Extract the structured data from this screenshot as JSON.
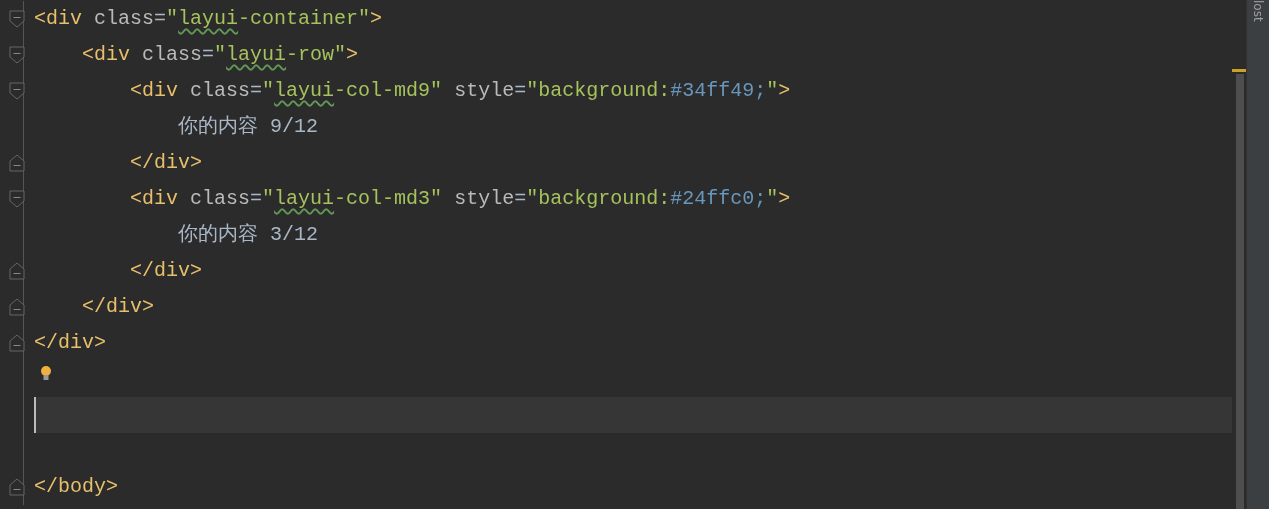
{
  "editor": {
    "lines": [
      {
        "kind": "open",
        "current": false,
        "bulb": false,
        "tokens": [
          {
            "kind": "tag",
            "text": "<div"
          },
          {
            "kind": "attr",
            "text": " class"
          },
          {
            "kind": "punct",
            "text": "="
          },
          {
            "kind": "string",
            "text": "\""
          },
          {
            "kind": "typo",
            "text": "layui"
          },
          {
            "kind": "string",
            "text": "-container\""
          },
          {
            "kind": "tag",
            "text": ">"
          }
        ]
      },
      {
        "kind": "open",
        "current": false,
        "bulb": false,
        "tokens": [
          {
            "kind": "tag",
            "text": "    <div"
          },
          {
            "kind": "attr",
            "text": " class"
          },
          {
            "kind": "punct",
            "text": "="
          },
          {
            "kind": "string",
            "text": "\""
          },
          {
            "kind": "typo",
            "text": "layui"
          },
          {
            "kind": "string",
            "text": "-row\""
          },
          {
            "kind": "tag",
            "text": ">"
          }
        ]
      },
      {
        "kind": "open",
        "current": false,
        "bulb": false,
        "tokens": [
          {
            "kind": "tag",
            "text": "        <div"
          },
          {
            "kind": "attr",
            "text": " class"
          },
          {
            "kind": "punct",
            "text": "="
          },
          {
            "kind": "string",
            "text": "\""
          },
          {
            "kind": "typo",
            "text": "layui"
          },
          {
            "kind": "string",
            "text": "-col-md9\""
          },
          {
            "kind": "attr",
            "text": " style"
          },
          {
            "kind": "punct",
            "text": "="
          },
          {
            "kind": "string",
            "text": "\"background:"
          },
          {
            "kind": "css",
            "text": "#34ff49;"
          },
          {
            "kind": "string",
            "text": "\""
          },
          {
            "kind": "tag",
            "text": ">"
          }
        ]
      },
      {
        "kind": "plain",
        "current": false,
        "bulb": false,
        "tokens": [
          {
            "kind": "text",
            "text": "            你的内容 9/12"
          }
        ]
      },
      {
        "kind": "close",
        "current": false,
        "bulb": false,
        "tokens": [
          {
            "kind": "tag",
            "text": "        </div>"
          }
        ]
      },
      {
        "kind": "open",
        "current": false,
        "bulb": false,
        "tokens": [
          {
            "kind": "tag",
            "text": "        <div"
          },
          {
            "kind": "attr",
            "text": " class"
          },
          {
            "kind": "punct",
            "text": "="
          },
          {
            "kind": "string",
            "text": "\""
          },
          {
            "kind": "typo",
            "text": "layui"
          },
          {
            "kind": "string",
            "text": "-col-md3\""
          },
          {
            "kind": "attr",
            "text": " style"
          },
          {
            "kind": "punct",
            "text": "="
          },
          {
            "kind": "string",
            "text": "\"background:"
          },
          {
            "kind": "css",
            "text": "#24ffc0;"
          },
          {
            "kind": "string",
            "text": "\""
          },
          {
            "kind": "tag",
            "text": ">"
          }
        ]
      },
      {
        "kind": "plain",
        "current": false,
        "bulb": false,
        "tokens": [
          {
            "kind": "text",
            "text": "            你的内容 3/12"
          }
        ]
      },
      {
        "kind": "close",
        "current": false,
        "bulb": false,
        "tokens": [
          {
            "kind": "tag",
            "text": "        </div>"
          }
        ]
      },
      {
        "kind": "close",
        "current": false,
        "bulb": false,
        "tokens": [
          {
            "kind": "tag",
            "text": "    </div>"
          }
        ]
      },
      {
        "kind": "close",
        "current": false,
        "bulb": false,
        "tokens": [
          {
            "kind": "tag",
            "text": "</div>"
          }
        ]
      },
      {
        "kind": "plain",
        "current": false,
        "bulb": true
      },
      {
        "kind": "plain",
        "current": true,
        "bulb": false
      },
      {
        "kind": "plain",
        "current": false,
        "bulb": false
      },
      {
        "kind": "close",
        "current": false,
        "bulb": false,
        "tokens": [
          {
            "kind": "tag",
            "text": "</body>"
          }
        ]
      }
    ]
  },
  "side_panel": {
    "label": "lost"
  }
}
